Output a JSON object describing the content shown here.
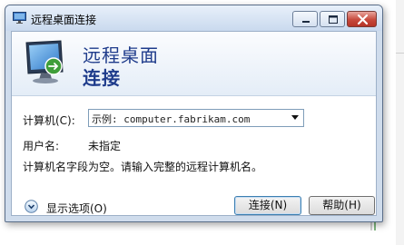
{
  "window": {
    "title": "远程桌面连接"
  },
  "header": {
    "line1": "远程桌面",
    "line2": "连接"
  },
  "form": {
    "computer_label": "计算机(C):",
    "computer_placeholder": "示例: computer.fabrikam.com",
    "username_label": "用户名:",
    "username_value": "未指定",
    "message": "计算机名字段为空。请输入完整的远程计算机名。"
  },
  "options": {
    "label": "显示选项(O)"
  },
  "buttons": {
    "connect": "连接(N)",
    "help": "帮助(H)"
  }
}
